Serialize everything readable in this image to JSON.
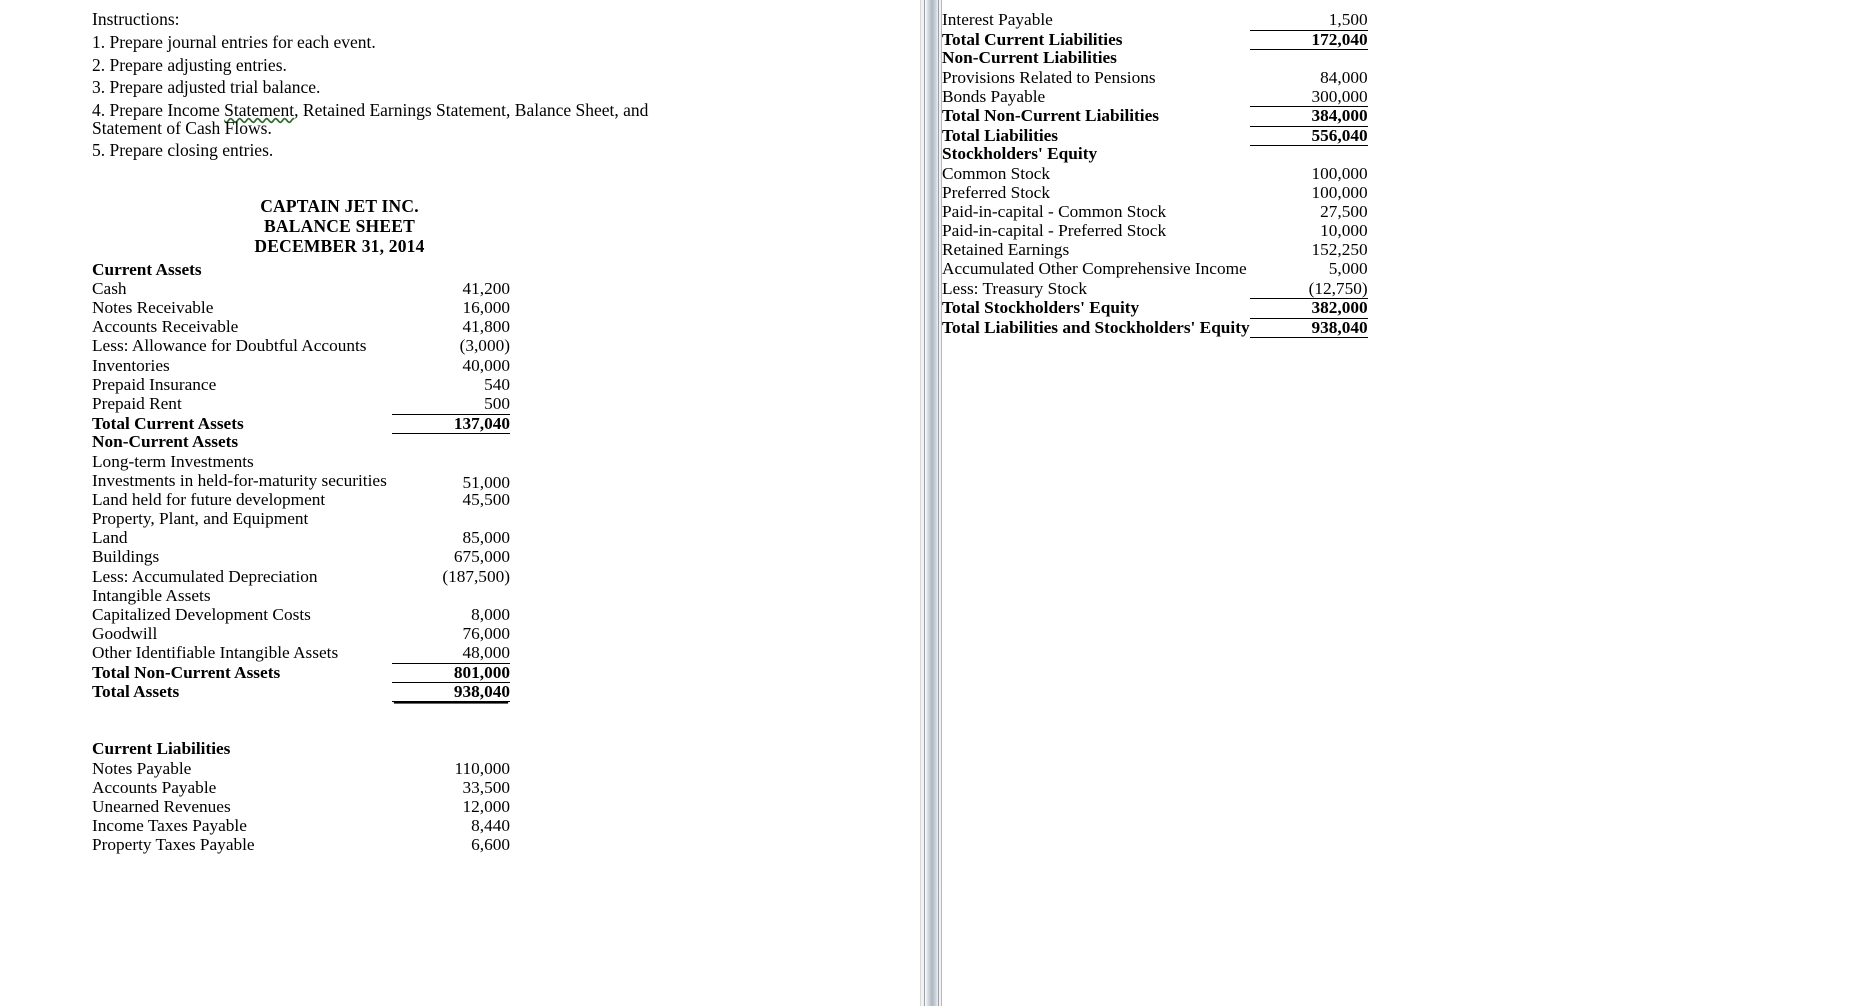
{
  "instructions": {
    "heading": "Instructions:",
    "items": [
      "1. Prepare journal entries for each event.",
      "2. Prepare adjusting entries.",
      "3. Prepare adjusted trial balance.",
      "5. Prepare closing entries."
    ],
    "item4_part1": "4. Prepare Income ",
    "item4_misspelled": "Statement",
    "item4_part2": ", Retained Earnings Statement, Balance Sheet, and Statement of Cash Flows."
  },
  "statement": {
    "company": "CAPTAIN JET INC.",
    "title": "BALANCE SHEET",
    "date": "DECEMBER 31, 2014"
  },
  "left": {
    "current_assets_header": "Current Assets",
    "rows_current_assets": [
      {
        "label": "Cash",
        "amount": "41,200"
      },
      {
        "label": "Notes Receivable",
        "amount": "16,000"
      },
      {
        "label": "Accounts Receivable",
        "amount": "41,800"
      },
      {
        "label": "Less: Allowance for Doubtful Accounts",
        "amount": "(3,000)"
      },
      {
        "label": "Inventories",
        "amount": "40,000"
      },
      {
        "label": "Prepaid Insurance",
        "amount": "540"
      },
      {
        "label": "Prepaid Rent",
        "amount": "500"
      }
    ],
    "total_current_assets_label": "Total Current Assets",
    "total_current_assets_amount": "137,040",
    "non_current_assets_header": "Non-Current Assets",
    "long_term_investments_header": "Long-term Investments",
    "held_to_maturity_label": "Investments in held-for-maturity securities",
    "held_to_maturity_amount": "51,000",
    "land_future_label": "Land held for future development",
    "land_future_amount": "45,500",
    "ppe_header": "Property, Plant, and Equipment",
    "rows_ppe": [
      {
        "label": "Land",
        "amount": "85,000"
      },
      {
        "label": "Buildings",
        "amount": "675,000"
      },
      {
        "label": "Less: Accumulated Depreciation",
        "amount": "(187,500)"
      }
    ],
    "intangible_header": "Intangible Assets",
    "rows_intangible": [
      {
        "label": "Capitalized Development Costs",
        "amount": "8,000"
      },
      {
        "label": "Goodwill",
        "amount": "76,000"
      },
      {
        "label": "Other Identifiable Intangible Assets",
        "amount": "48,000"
      }
    ],
    "total_non_current_assets_label": "Total Non-Current Assets",
    "total_non_current_assets_amount": "801,000",
    "total_assets_label": "Total Assets",
    "total_assets_amount": "938,040",
    "current_liabilities_header": "Current Liabilities",
    "rows_current_liabilities": [
      {
        "label": "Notes Payable",
        "amount": "110,000"
      },
      {
        "label": "Accounts Payable",
        "amount": "33,500"
      },
      {
        "label": "Unearned Revenues",
        "amount": "12,000"
      },
      {
        "label": "Income Taxes Payable",
        "amount": "8,440"
      },
      {
        "label": "Property Taxes Payable",
        "amount": "6,600"
      }
    ]
  },
  "right": {
    "interest_payable_label": "Interest Payable",
    "interest_payable_amount": "1,500",
    "total_current_liabilities_label": "Total Current Liabilities",
    "total_current_liabilities_amount": "172,040",
    "non_current_liabilities_header": "Non-Current Liabilities",
    "rows_non_current_liabilities": [
      {
        "label": "Provisions Related to Pensions",
        "amount": "84,000"
      },
      {
        "label": "Bonds Payable",
        "amount": "300,000"
      }
    ],
    "total_non_current_liabilities_label": "Total Non-Current Liabilities",
    "total_non_current_liabilities_amount": "384,000",
    "total_liabilities_label": "Total Liabilities",
    "total_liabilities_amount": "556,040",
    "equity_header": "Stockholders' Equity",
    "rows_equity": [
      {
        "label": "Common Stock",
        "amount": "100,000"
      },
      {
        "label": "Preferred Stock",
        "amount": "100,000"
      },
      {
        "label": "Paid-in-capital - Common Stock",
        "amount": "27,500"
      },
      {
        "label": "Paid-in-capital - Preferred Stock",
        "amount": "10,000"
      },
      {
        "label": "Retained Earnings",
        "amount": "152,250"
      },
      {
        "label": "Accumulated Other Comprehensive Income",
        "amount": "5,000"
      },
      {
        "label": "Less: Treasury Stock",
        "amount": "(12,750)"
      }
    ],
    "total_equity_label": "Total Stockholders' Equity",
    "total_equity_amount": "382,000",
    "total_liab_equity_label": "Total Liabilities and Stockholders' Equity",
    "total_liab_equity_amount": "938,040"
  }
}
